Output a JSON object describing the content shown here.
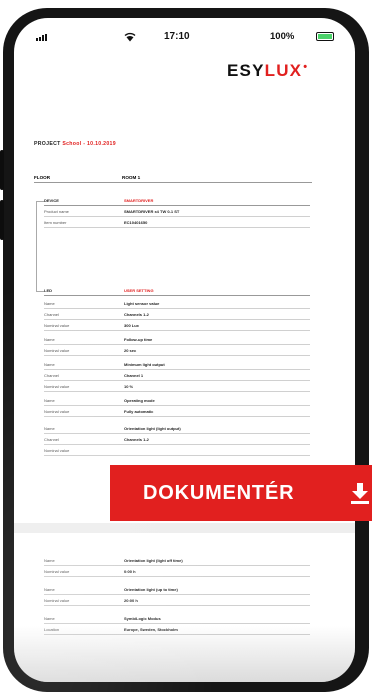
{
  "status_bar": {
    "time": "17:10",
    "battery": "100%"
  },
  "brand": {
    "logo_main": "ESY",
    "logo_accent": "LUX",
    "logo_dot": "•"
  },
  "project": {
    "label": "PROJECT",
    "name": "School - 10.10.2019"
  },
  "table_header": {
    "floor": "FLOOR",
    "room": "ROOM 1"
  },
  "device": {
    "title": {
      "key": "DEVICE",
      "value": "SMARTDRIVER"
    },
    "rows": [
      {
        "key": "Product name",
        "value": "SMARTDRIVER x4 TW 0-1 ST"
      },
      {
        "key": "Item number",
        "value": "EC10401650"
      }
    ]
  },
  "led": {
    "title": {
      "key": "LED",
      "value": "USER SETTING"
    },
    "rows": [
      {
        "key": "Name",
        "value": "Light sensor value"
      },
      {
        "key": "Channel",
        "value": "Channels 1-2"
      },
      {
        "key": "Nominal value",
        "value": "300 Lux"
      },
      {
        "key": "Name",
        "value": "Follow-up time"
      },
      {
        "key": "Nominal value",
        "value": "20 sec"
      },
      {
        "key": "Name",
        "value": "Minimum light output"
      },
      {
        "key": "Channel",
        "value": "Channel 1"
      },
      {
        "key": "Nominal value",
        "value": "10 %"
      },
      {
        "key": "Name",
        "value": "Operating mode"
      },
      {
        "key": "Nominal value",
        "value": "Fully automatic"
      },
      {
        "key": "Name",
        "value": "Orientation light (light output)"
      },
      {
        "key": "Channel",
        "value": "Channels 1-2"
      },
      {
        "key": "Nominal value",
        "value": ""
      }
    ]
  },
  "lower": {
    "rows": [
      {
        "key": "Name",
        "value": "Orientation light (light off time)"
      },
      {
        "key": "Nominal value",
        "value": "0:00 h"
      },
      {
        "key": "Name",
        "value": "Orientation light (up to time)"
      },
      {
        "key": "Nominal value",
        "value": "20:00 h"
      },
      {
        "key": "Name",
        "value": "SymbiLogic Modus"
      },
      {
        "key": "Location",
        "value": "Europe, Sweden, Stockholm"
      }
    ]
  },
  "cta": {
    "label": "DOKUMENTÉR"
  },
  "icons": {
    "download": "download-icon",
    "wifi": "wifi-icon",
    "signal": "signal-icon",
    "battery": "battery-icon"
  },
  "colors": {
    "accent": "#e1201f",
    "battery_fill": "#4bd26a",
    "phone_frame": "#151515"
  }
}
